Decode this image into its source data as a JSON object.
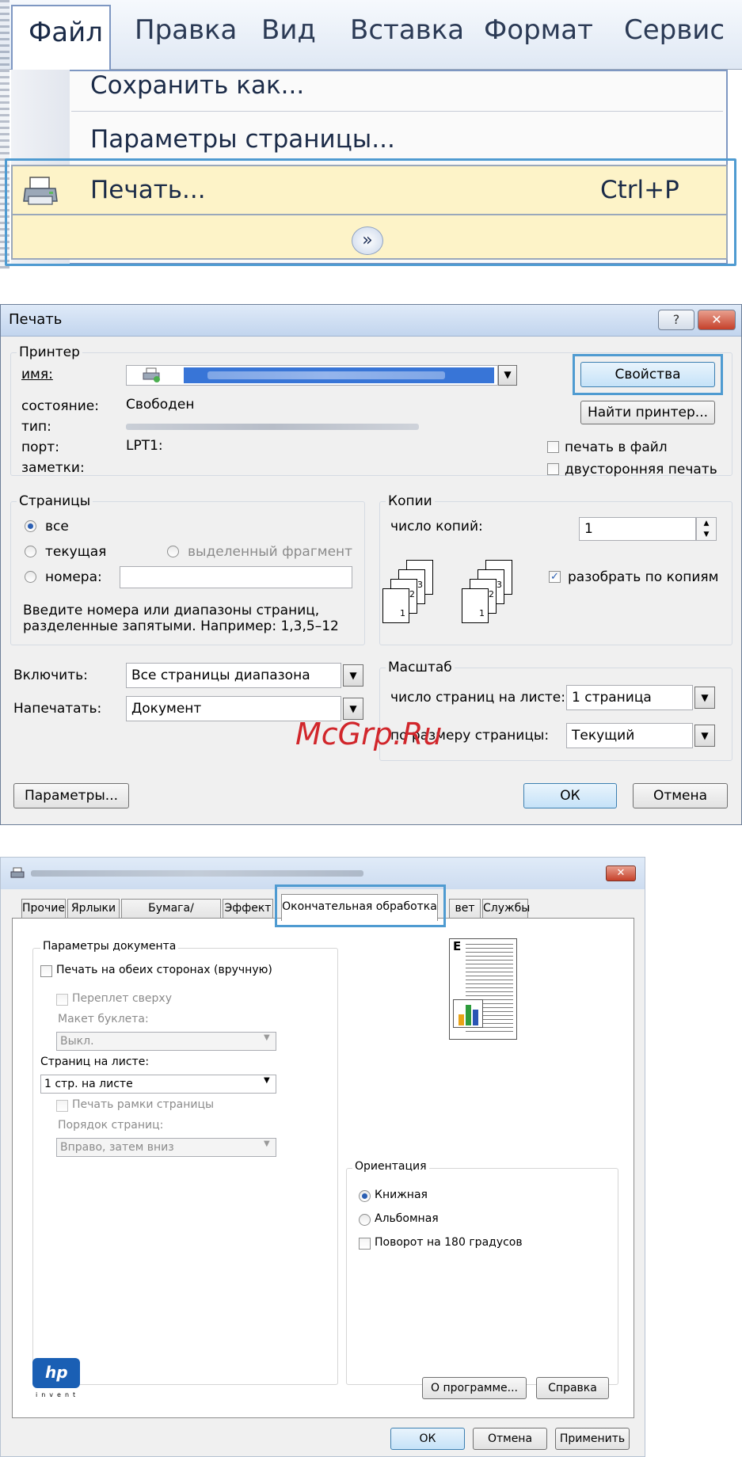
{
  "menu": {
    "bar_items": [
      "Файл",
      "Правка",
      "Вид",
      "Вставка",
      "Формат",
      "Сервис"
    ],
    "dropdown": {
      "save_as": "Сохранить как...",
      "page_setup": "Параметры страницы...",
      "print": "Печать...",
      "print_shortcut": "Ctrl+P"
    },
    "highlight_color": "#4f9bd1",
    "selected_item_bg": "#fdf3c8"
  },
  "print_dialog": {
    "title": "Печать",
    "help_button": "?",
    "close_button": "✕",
    "printer": {
      "group_label": "Принтер",
      "name_label": "имя:",
      "status_label": "состояние:",
      "status_value": "Свободен",
      "type_label": "тип:",
      "port_label": "порт:",
      "port_value": "LPT1:",
      "notes_label": "заметки:",
      "properties_button": "Свойства",
      "find_printer_button": "Найти принтер...",
      "print_to_file": "печать в файл",
      "duplex": "двусторонняя печать"
    },
    "pages": {
      "group_label": "Страницы",
      "all": "все",
      "current": "текущая",
      "selection": "выделенный фрагмент",
      "numbers": "номера:",
      "hint_line1": "Введите номера или диапазоны страниц,",
      "hint_line2": "разделенные запятыми. Например: 1,3,5–12"
    },
    "copies": {
      "group_label": "Копии",
      "count_label": "число копий:",
      "count_value": "1",
      "collate": "разобрать по копиям",
      "page_labels": [
        "1",
        "2",
        "3"
      ]
    },
    "include_label": "Включить:",
    "include_value": "Все страницы диапазона",
    "print_what_label": "Напечатать:",
    "print_what_value": "Документ",
    "zoom": {
      "group_label": "Масштаб",
      "pages_per_sheet_label": "число страниц на листе:",
      "pages_per_sheet_value": "1 страница",
      "scale_label": "по размеру страницы:",
      "scale_value": "Текущий"
    },
    "options_button": "Параметры...",
    "ok_button": "ОК",
    "cancel_button": "Отмена",
    "watermark": "McGrp.Ru"
  },
  "properties_dialog": {
    "close_button": "✕",
    "tabs": [
      "Прочие",
      "Ярлыки",
      "Бумага/качество",
      "Эффект",
      "Окончательная обработка",
      "вет",
      "Службы"
    ],
    "document_options": {
      "group_label": "Параметры документа",
      "duplex_manual": "Печать на обеих сторонах (вручную)",
      "flip_up": "Переплет сверху",
      "booklet_label": "Макет буклета:",
      "booklet_value": "Выкл.",
      "pages_per_sheet_label": "Страниц на листе:",
      "pages_per_sheet_value": "1 стр. на листе",
      "print_borders": "Печать рамки страницы",
      "page_order_label": "Порядок страниц:",
      "page_order_value": "Вправо, затем вниз"
    },
    "orientation": {
      "group_label": "Ориентация",
      "portrait": "Книжная",
      "landscape": "Альбомная",
      "rotate": "Поворот на 180 градусов"
    },
    "preview_letter": "E",
    "hp_logo": "hp",
    "hp_tagline": "invent",
    "about_button": "О программе...",
    "help_button": "Справка",
    "ok_button": "ОК",
    "cancel_button": "Отмена",
    "apply_button": "Применить"
  }
}
